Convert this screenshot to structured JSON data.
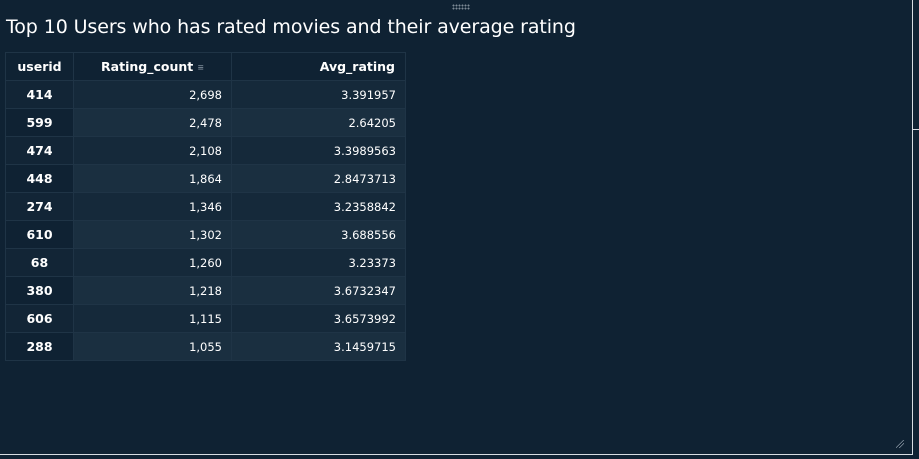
{
  "visual": {
    "title": "Top 10 Users who has rated movies and their average rating"
  },
  "table": {
    "headers": {
      "userid": "userid",
      "rating_count": "Rating_count",
      "avg_rating": "Avg_rating"
    },
    "sort_icon": "sort-descending-icon",
    "rows": [
      {
        "userid": "414",
        "rating_count": "2,698",
        "avg_rating": "3.391957"
      },
      {
        "userid": "599",
        "rating_count": "2,478",
        "avg_rating": "2.64205"
      },
      {
        "userid": "474",
        "rating_count": "2,108",
        "avg_rating": "3.3989563"
      },
      {
        "userid": "448",
        "rating_count": "1,864",
        "avg_rating": "2.8473713"
      },
      {
        "userid": "274",
        "rating_count": "1,346",
        "avg_rating": "3.2358842"
      },
      {
        "userid": "610",
        "rating_count": "1,302",
        "avg_rating": "3.688556"
      },
      {
        "userid": "68",
        "rating_count": "1,260",
        "avg_rating": "3.23373"
      },
      {
        "userid": "380",
        "rating_count": "1,218",
        "avg_rating": "3.6732347"
      },
      {
        "userid": "606",
        "rating_count": "1,115",
        "avg_rating": "3.6573992"
      },
      {
        "userid": "288",
        "rating_count": "1,055",
        "avg_rating": "3.1459715"
      }
    ]
  },
  "colors": {
    "background": "#0f2233",
    "text": "#ffffff",
    "row_even": "#15293a",
    "row_odd": "#1a2f40"
  }
}
